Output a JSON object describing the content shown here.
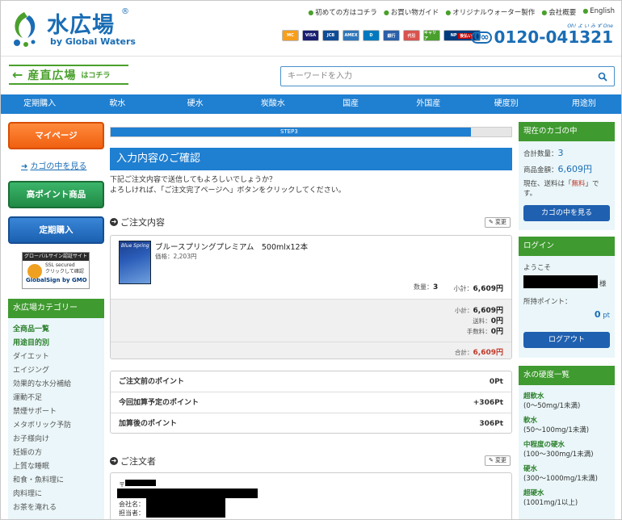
{
  "header": {
    "logo_main": "水広場",
    "logo_reg": "®",
    "logo_sub": "by Global Waters",
    "top_links": [
      "初めての方はコチラ",
      "お買い物ガイド",
      "オリジナルウォーター製作",
      "会社概要",
      "English"
    ],
    "cards": [
      "MC",
      "VISA",
      "JCB",
      "AMEX",
      "D",
      "銀行",
      "代引",
      "キャリア",
      "NP",
      "後払い"
    ],
    "phone_kana": "Oh! よ い み ず One",
    "phone_fd": "0∞",
    "phone": "0120-041321",
    "sanchoku_arrow": "←",
    "sanchoku_label": "産直広場",
    "sanchoku_small": "はコチラ",
    "search_placeholder": "キーワードを入力"
  },
  "nav": [
    "定期購入",
    "軟水",
    "硬水",
    "炭酸水",
    "国産",
    "外国産",
    "硬度別",
    "用途別"
  ],
  "left": {
    "mypage": "マイページ",
    "cart_link": "カゴの中を見る",
    "high_point": "高ポイント商品",
    "subscription": "定期購入",
    "globalsign_top": "グローバルサイン認証サイト",
    "globalsign_mid1": "SSL secured",
    "globalsign_mid2": "クリックして確認",
    "globalsign_bot": "GlobalSign by GMO",
    "category_head": "水広場カテゴリー",
    "categories": [
      "全商品一覧",
      "用途目的別",
      "ダイエット",
      "エイジング",
      "効果的な水分補給",
      "運動不足",
      "禁煙サポート",
      "メタボリック予防",
      "お子様向け",
      "妊娠の方",
      "上質な睡眠",
      "和食・魚料理に",
      "肉料理に",
      "お茶を淹れる"
    ]
  },
  "main": {
    "progress_label": "STEP3",
    "progress_fraction": 0.9,
    "title": "入力内容のご確認",
    "intro_1": "下記ご注文内容で送信してもよろしいでしょうか？",
    "intro_2": "よろしければ、「ご注文完了ページへ」ボタンをクリックしてください。",
    "order_section": "ご注文内容",
    "edit": "変更",
    "product_img_label": "Blue Spring",
    "product_name": "ブルースプリングプレミアム　500mlx12本",
    "product_price_label": "価格：",
    "product_price": "2,203円",
    "qty_label": "数量：",
    "qty": "3",
    "line_subtotal_label": "小計：",
    "line_subtotal": "6,609円",
    "subtotal_label": "小計：",
    "subtotal": "6,609円",
    "shipping_label": "送料：",
    "shipping": "0円",
    "fee_label": "手数料：",
    "fee": "0円",
    "total_label": "合計：",
    "total": "6,609円",
    "points": [
      {
        "label": "ご注文前のポイント",
        "value": "0Pt"
      },
      {
        "label": "今回加算予定のポイント",
        "value": "+306Pt"
      },
      {
        "label": "加算後のポイント",
        "value": "306Pt"
      }
    ],
    "buyer_section": "ご注文者",
    "postal_prefix": "〒",
    "company_label": "会社名：",
    "contact_label": "担当者："
  },
  "right": {
    "cart_head": "現在のカゴの中",
    "cart_qty_label": "合計数量：",
    "cart_qty": "3",
    "cart_amount_label": "商品金額：",
    "cart_amount": "6,609円",
    "shipping_note_1": "現在、送料は「",
    "shipping_free": "無料",
    "shipping_note_2": "」で",
    "shipping_note_3": "す。",
    "cart_btn": "カゴの中を見る",
    "login_head": "ログイン",
    "welcome": "ようこそ",
    "sama": "様",
    "points_label": "所持ポイント：",
    "points_value": "0",
    "points_unit": "pt",
    "logout": "ログアウト",
    "hardness_head": "水の硬度一覧",
    "hardness": [
      {
        "name": "超軟水",
        "range": "(0〜50mg/1未満)"
      },
      {
        "name": "軟水",
        "range": "(50〜100mg/1未満)"
      },
      {
        "name": "中程度の硬水",
        "range": "(100〜300mg/1未満)"
      },
      {
        "name": "硬水",
        "range": "(300〜1000mg/1未満)"
      },
      {
        "name": "超硬水",
        "range": "(1001mg/1以上)"
      }
    ]
  }
}
